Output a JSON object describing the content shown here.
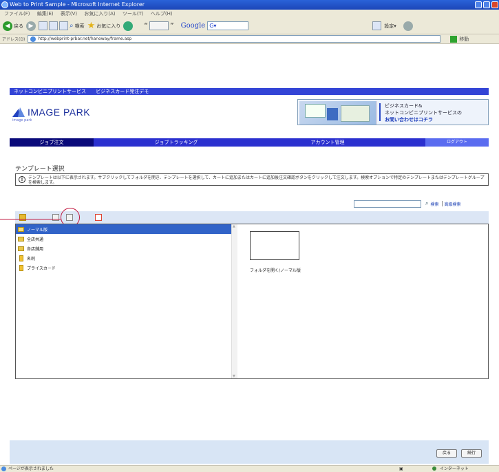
{
  "window": {
    "title": "Web to Print Sample - Microsoft Internet Explorer",
    "menu": [
      "ファイル(F)",
      "編集(E)",
      "表示(V)",
      "お気に入り(A)",
      "ツール(T)",
      "ヘルプ(H)"
    ],
    "toolbar": {
      "back_label": "戻る",
      "search_label": "検索",
      "favorites_label": "お気に入り",
      "google_label": "Google",
      "google_value": "G▾",
      "settings_label": "設定▾"
    },
    "address_label": "アドレス(D)",
    "address_value": "http://webprint-prbar.net/hanoway/frame.asp",
    "go_label": "移動"
  },
  "site": {
    "top_nav": [
      "ネットコンビニプリントサービス",
      "ビジネスカード発注デモ"
    ],
    "logo_text": "IMAGE PARK",
    "logo_sub": "image park",
    "banner_lines": [
      "ビジネスカード&",
      "ネットコンビニプリントサービスの",
      "お問い合わせはコチラ"
    ],
    "main_nav": [
      {
        "label": "ジョブ注文",
        "active": true
      },
      {
        "label": "ジョブトラッキング",
        "active": false
      },
      {
        "label": "アカウント管理",
        "active": false
      }
    ],
    "logout_label": "ログアウト"
  },
  "content": {
    "section_title": "テンプレート選択",
    "notice_text": "テンプレートは以下に表示されます。サブクリックしてフォルダを開き、テンプレートを選択して、カートに追加またはカートに追加後注文確認ボタンをクリックして注文します。検索オプションで特定のテンプレートまたはテンプレートグループを検索します。",
    "search": {
      "placeholder": "",
      "search_label": "検索",
      "advanced_label": "高級検索"
    },
    "tree": [
      {
        "label": "ノーマル版",
        "type": "folder-open",
        "selected": true
      },
      {
        "label": "全店共通",
        "type": "folder",
        "selected": false
      },
      {
        "label": "各店舗用",
        "type": "folder",
        "selected": false
      },
      {
        "label": "名刺",
        "type": "doc",
        "selected": false
      },
      {
        "label": "プライスカード",
        "type": "doc",
        "selected": false
      }
    ],
    "thumbnail_label": "フォルダを開く/ノーマル版"
  },
  "footer": {
    "back_button": "戻る",
    "next_button": "続行"
  },
  "statusbar": {
    "left_text": "ページが表示されました",
    "zone_text": "インターネット"
  }
}
